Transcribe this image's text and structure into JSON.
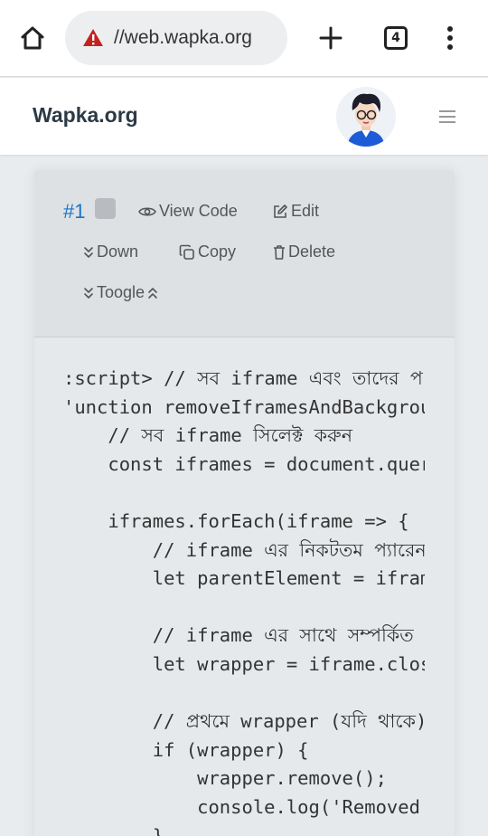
{
  "browser": {
    "url": "//web.wapka.org",
    "tab_count": "4"
  },
  "site": {
    "brand": "Wapka.org"
  },
  "card": {
    "item_number": "#1",
    "actions": {
      "view_code": "View Code",
      "edit": "Edit",
      "down": "Down",
      "copy": "Copy",
      "delete": "Delete",
      "toogle": "Toogle"
    },
    "code_lines": [
      ":script> // সব iframe এবং তাদের প",
      "'unction removeIframesAndBackgrou",
      "    // সব iframe সিলেক্ট করুন",
      "    const iframes = document.quer",
      "",
      "    iframes.forEach(iframe => {",
      "        // iframe এর নিকটতম প্যারেন",
      "        let parentElement = ifram",
      "",
      "        // iframe এর সাথে সম্পর্কিত",
      "        let wrapper = iframe.clos",
      "",
      "        // প্রথমে wrapper (যদি থাকে)",
      "        if (wrapper) {",
      "            wrapper.remove();",
      "            console.log('Removed",
      "        }"
    ]
  }
}
